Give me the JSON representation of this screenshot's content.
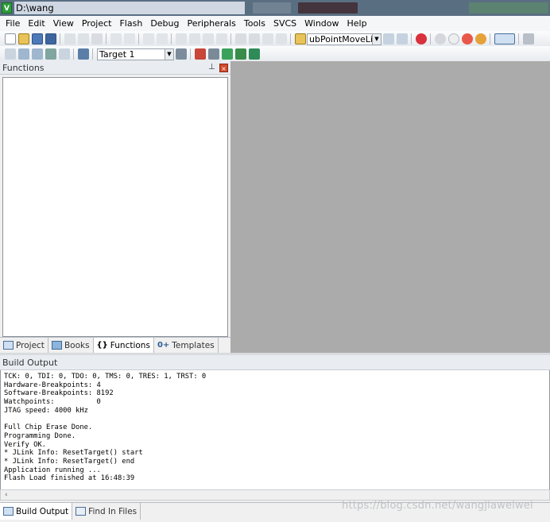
{
  "window": {
    "title": "D:\\wang jw\\TEST\\download_hex\\download_hex.uvprojx - µVision",
    "app_icon": "V"
  },
  "menu": [
    "File",
    "Edit",
    "View",
    "Project",
    "Flash",
    "Debug",
    "Peripherals",
    "Tools",
    "SVCS",
    "Window",
    "Help"
  ],
  "toolbar": {
    "find_combo": "ubPointMoveLinkAg",
    "target_select": "Target 1"
  },
  "functions_pane": {
    "title": "Functions",
    "pin_icon": "pin-icon",
    "close_icon": "close-icon",
    "tabs": [
      {
        "label": "Project",
        "icon": "project-icon"
      },
      {
        "label": "Books",
        "icon": "books-icon"
      },
      {
        "label": "Functions",
        "icon": "functions-icon",
        "glyph": "{}"
      },
      {
        "label": "Templates",
        "icon": "templates-icon",
        "glyph": "0+"
      }
    ]
  },
  "build_output": {
    "title": "Build Output",
    "lines": [
      "TCK: 0, TDI: 0, TDO: 0, TMS: 0, TRES: 1, TRST: 0",
      "Hardware-Breakpoints: 4",
      "Software-Breakpoints: 8192",
      "Watchpoints:          0",
      "JTAG speed: 4000 kHz",
      "",
      "Full Chip Erase Done.",
      "Programming Done.",
      "Verify OK.",
      "* JLink Info: ResetTarget() start",
      "* JLink Info: ResetTarget() end",
      "Application running ...",
      "Flash Load finished at 16:48:39"
    ],
    "scroll_left": "‹",
    "tabs": [
      {
        "label": "Build Output",
        "icon": "build-output-icon"
      },
      {
        "label": "Find In Files",
        "icon": "find-in-files-icon"
      }
    ]
  },
  "watermark": "https://blog.csdn.net/wangjiaweiwei",
  "colors": {
    "editor_bg": "#ababab",
    "titlebar": "#5a6e82"
  }
}
